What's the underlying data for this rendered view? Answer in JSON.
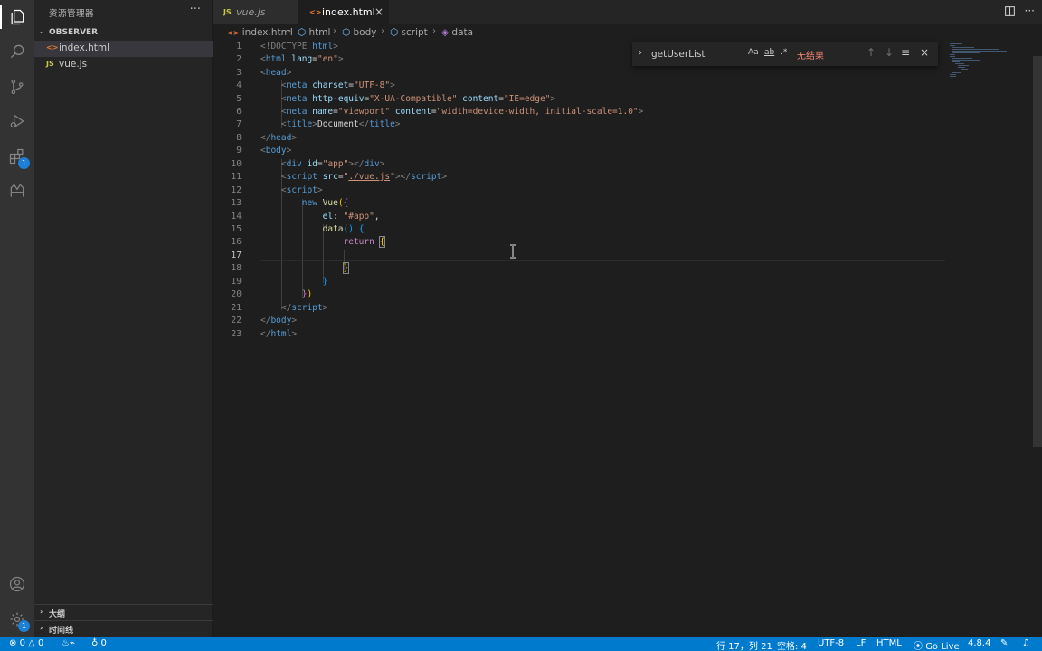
{
  "sidebar": {
    "title": "资源管理器",
    "more": "···",
    "section": "OBSERVER",
    "files": [
      {
        "name": "index.html",
        "icon": "<>",
        "type": "html",
        "selected": true
      },
      {
        "name": "vue.js",
        "icon": "JS",
        "type": "js",
        "selected": false
      }
    ],
    "bottom_sections": [
      "大纲",
      "时间线"
    ]
  },
  "activity_bar": {
    "icons": [
      "explorer-icon",
      "search-icon",
      "source-control-icon",
      "run-debug-icon",
      "extensions-icon",
      "remote-explorer-icon",
      "account-icon",
      "settings-gear-icon"
    ],
    "extensions_badge": "1",
    "settings_badge": "1"
  },
  "tabs": [
    {
      "label": "vue.js",
      "icon": "JS",
      "active": false
    },
    {
      "label": "index.html",
      "icon": "<>",
      "active": true,
      "close": "×"
    }
  ],
  "breadcrumb": [
    "index.html",
    "html",
    "body",
    "script",
    "data"
  ],
  "find": {
    "query": "getUserList",
    "match_case": "Aa",
    "whole_word": "ab",
    "regex": ".*",
    "result": "无结果"
  },
  "editor": {
    "active_line": 17,
    "line_numbers": [
      "1",
      "2",
      "3",
      "4",
      "5",
      "6",
      "7",
      "8",
      "9",
      "10",
      "11",
      "12",
      "13",
      "14",
      "15",
      "16",
      "17",
      "18",
      "19",
      "20",
      "21",
      "22",
      "23"
    ]
  },
  "code": {
    "l1_a": "<!DOCTYPE",
    "l1_b": "html",
    "l1_c": ">",
    "l2_a": "<",
    "l2_tag": "html",
    "l2_attr": "lang",
    "l2_eq": "=",
    "l2_val": "\"en\"",
    "l2_end": ">",
    "l3_a": "<",
    "l3_tag": "head",
    "l3_end": ">",
    "l4_a": "<",
    "l4_tag": "meta",
    "l4_attr": "charset",
    "l4_eq": "=",
    "l4_val": "\"UTF-8\"",
    "l4_end": ">",
    "l5_a": "<",
    "l5_tag": "meta",
    "l5_attr": "http-equiv",
    "l5_eq": "=",
    "l5_val": "\"X-UA-Compatible\"",
    "l5_attr2": "content",
    "l5_eq2": "=",
    "l5_val2": "\"IE=edge\"",
    "l5_end": ">",
    "l6_a": "<",
    "l6_tag": "meta",
    "l6_attr": "name",
    "l6_eq": "=",
    "l6_val": "\"viewport\"",
    "l6_attr2": "content",
    "l6_eq2": "=",
    "l6_val2": "\"width=device-width, initial-scale=1.0\"",
    "l6_end": ">",
    "l7_a": "<",
    "l7_tag": "title",
    "l7_gt": ">",
    "l7_text": "Document",
    "l7_close_a": "</",
    "l7_close_tag": "title",
    "l7_end": ">",
    "l8_a": "</",
    "l8_tag": "head",
    "l8_end": ">",
    "l9_a": "<",
    "l9_tag": "body",
    "l9_end": ">",
    "l10_a": "<",
    "l10_tag": "div",
    "l10_attr": "id",
    "l10_eq": "=",
    "l10_val": "\"app\"",
    "l10_gt": ">",
    "l10_close_a": "</",
    "l10_close_tag": "div",
    "l10_end": ">",
    "l11_a": "<",
    "l11_tag": "script",
    "l11_attr": "src",
    "l11_eq": "=",
    "l11_q1": "\"",
    "l11_link": "./vue.js",
    "l11_q2": "\"",
    "l11_gt": ">",
    "l11_close_a": "</",
    "l11_close_tag": "script",
    "l11_end": ">",
    "l12_a": "<",
    "l12_tag": "script",
    "l12_end": ">",
    "l13_kw": "new",
    "l13_fn": "Vue",
    "l13_p": "(",
    "l13_b": "{",
    "l14_key": "el",
    "l14_colon": ": ",
    "l14_val": "\"#app\"",
    "l14_comma": ",",
    "l15_fn": "data",
    "l15_p": "()",
    "l15_b": "{",
    "l16_kw": "return",
    "l16_b": "{",
    "l18_b": "}",
    "l19_b": "}",
    "l20_b": "}",
    "l20_p": ")",
    "l21_a": "</",
    "l21_tag": "script",
    "l21_end": ">",
    "l22_a": "</",
    "l22_tag": "body",
    "l22_end": ">",
    "l23_a": "</",
    "l23_tag": "html",
    "l23_end": ">"
  },
  "statusbar": {
    "errors": "0",
    "warnings": "0",
    "ports": "0",
    "position": "行 17，列 21",
    "spaces": "空格: 4",
    "encoding": "UTF-8",
    "eol": "LF",
    "language": "HTML",
    "golive": "Go Live",
    "version": "4.8.4"
  },
  "colors": {
    "accent": "#007acc",
    "editor_bg": "#1e1e1e",
    "sidebar_bg": "#252526",
    "activity_bg": "#333333",
    "no_result": "#f48771"
  }
}
